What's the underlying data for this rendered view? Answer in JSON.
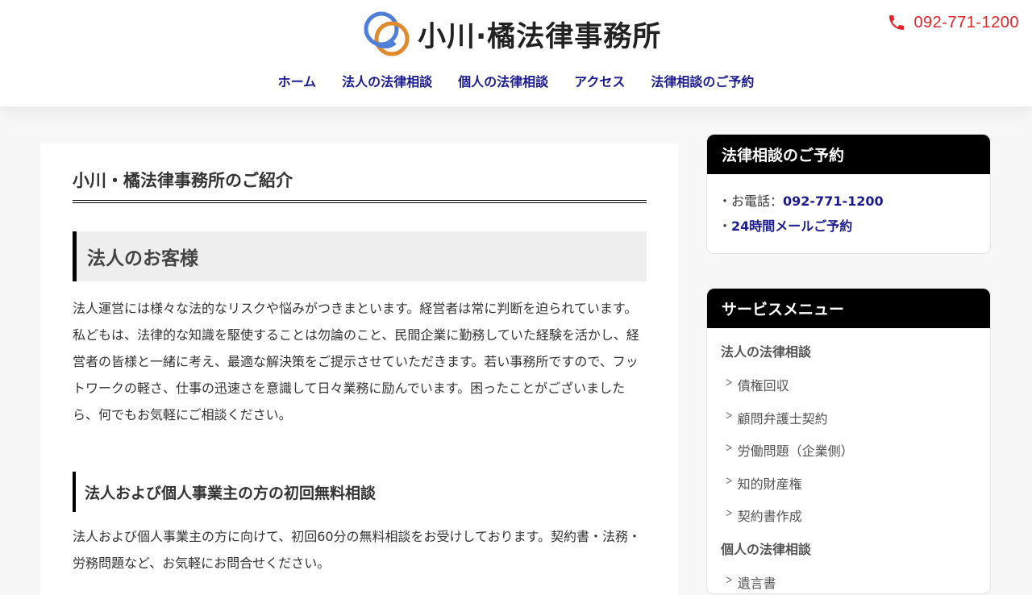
{
  "header": {
    "logo_text": "小川·橘法律事務所",
    "phone": "092-771-1200",
    "nav": [
      "ホーム",
      "法人の法律相談",
      "個人の法律相談",
      "アクセス",
      "法律相談のご予約"
    ]
  },
  "main": {
    "title": "小川・橘法律事務所のご紹介",
    "section_heading": "法人のお客様",
    "section_text": "法人運営には様々な法的なリスクや悩みがつきまといます。経営者は常に判断を迫られています。私どもは、法律的な知識を駆使することは勿論のこと、民間企業に勤務していた経験を活かし、経営者の皆様と一緒に考え、最適な解決策をご提示させていただきます。若い事務所ですので、フットワークの軽さ、仕事の迅速さを意識して日々業務に励んでいます。困ったことがございましたら、何でもお気軽にご相談ください。",
    "sub_heading": "法人および個人事業主の方の初回無料相談",
    "sub_text": "法人および個人事業主の方に向けて、初回60分の無料相談をお受けしております。契約書・法務・労務問題など、お気軽にお問合せください。"
  },
  "sidebar": {
    "reservation": {
      "title": "法律相談のご予約",
      "phone_prefix": "・お電話：",
      "phone": "092-771-1200",
      "mail_prefix": "・",
      "mail": "24時間メールご予約"
    },
    "services": {
      "title": "サービスメニュー",
      "corporate_heading": "法人の法律相談",
      "corporate_items": [
        "債権回収",
        "顧問弁護士契約",
        "労働問題（企業側）",
        "知的財産権",
        "契約書作成"
      ],
      "personal_heading": "個人の法律相談",
      "personal_items": [
        "遺言書"
      ]
    }
  },
  "colors": {
    "nav_link": "#1b1b8f",
    "phone": "#e0242b",
    "logo_blue": "#4f7fd6",
    "logo_orange": "#e08a2e"
  }
}
